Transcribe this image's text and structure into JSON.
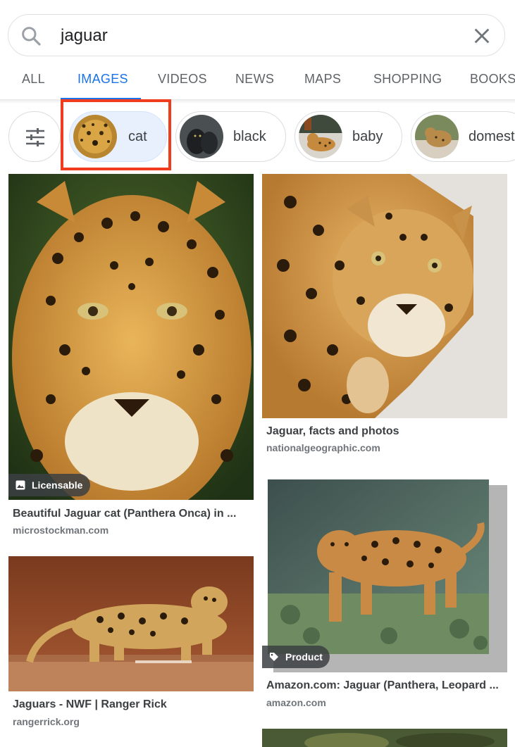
{
  "search": {
    "query": "jaguar"
  },
  "tabs": [
    {
      "label": "ALL"
    },
    {
      "label": "IMAGES"
    },
    {
      "label": "VIDEOS"
    },
    {
      "label": "NEWS"
    },
    {
      "label": "MAPS"
    },
    {
      "label": "SHOPPING"
    },
    {
      "label": "BOOKS"
    }
  ],
  "active_tab": "IMAGES",
  "chips": [
    {
      "label": "cat"
    },
    {
      "label": "black"
    },
    {
      "label": "baby"
    },
    {
      "label": "domest"
    }
  ],
  "results": [
    {
      "title": "Beautiful Jaguar cat (Panthera Onca) in ...",
      "source": "microstockman.com",
      "badge": "Licensable"
    },
    {
      "title": "Jaguar, facts and photos",
      "source": "nationalgeographic.com"
    },
    {
      "title": "Jaguars - NWF | Ranger Rick",
      "source": "rangerrick.org"
    },
    {
      "title": "Amazon.com: Jaguar (Panthera, Leopard ...",
      "source": "amazon.com",
      "badge": "Product"
    }
  ],
  "colors": {
    "accent": "#1a73e8",
    "highlight": "#f03c1c"
  }
}
